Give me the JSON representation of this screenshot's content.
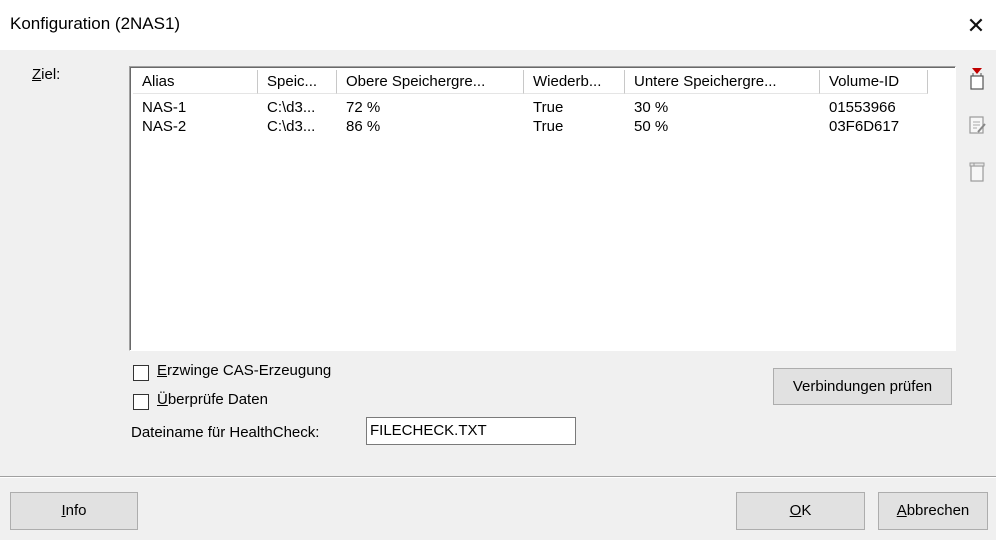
{
  "window": {
    "title": "Konfiguration (2NAS1)",
    "close_glyph": "✕"
  },
  "target_label": "Ziel:",
  "target_label_hotkey": "Z",
  "target_label_rest": "iel:",
  "table": {
    "columns": [
      "Alias",
      "Speic...",
      "Obere Speichergre...",
      "Wiederb...",
      "Untere Speichergre...",
      "Volume-ID"
    ],
    "rows": [
      [
        "NAS-1",
        "C:\\d3...",
        "72 %",
        "True",
        "30 %",
        "01553966"
      ],
      [
        "NAS-2",
        "C:\\d3...",
        "86 %",
        "True",
        "50 %",
        "03F6D617"
      ]
    ]
  },
  "side_icons": [
    "new-entry-icon",
    "edit-entry-icon",
    "delete-entry-icon"
  ],
  "options": {
    "force_cas": {
      "hotkey": "E",
      "rest": "rzwinge CAS-Erzeugung",
      "checked": false
    },
    "verify_data": {
      "hotkey": "Ü",
      "rest": "berprüfe Daten",
      "checked": false
    }
  },
  "healthcheck": {
    "label": "Dateiname für HealthCheck:",
    "value": "FILECHECK.TXT"
  },
  "buttons": {
    "check_connections": "Verbindungen prüfen",
    "info_hotkey": "I",
    "info_rest": "nfo",
    "ok_hotkey": "O",
    "ok_rest": "K",
    "cancel_hotkey": "A",
    "cancel_rest": "bbrechen"
  },
  "colors": {
    "accent_red": "#c00000",
    "window_bg": "#f0f0f0"
  }
}
